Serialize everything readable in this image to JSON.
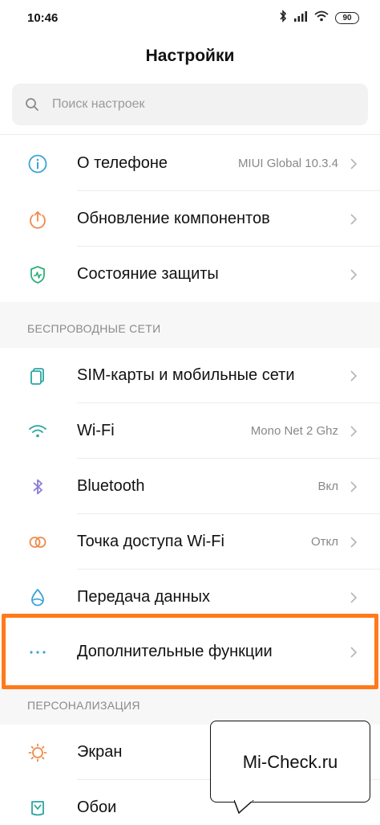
{
  "status_bar": {
    "time": "10:46",
    "battery": "90"
  },
  "header": {
    "title": "Настройки"
  },
  "search": {
    "placeholder": "Поиск настроек"
  },
  "rows_top": [
    {
      "label": "О телефоне",
      "value": "MIUI Global 10.3.4",
      "icon": "info-icon"
    },
    {
      "label": "Обновление компонентов",
      "value": "",
      "icon": "update-arrow-icon"
    },
    {
      "label": "Состояние защиты",
      "value": "",
      "icon": "shield-icon"
    }
  ],
  "section_wireless": {
    "title": "БЕСПРОВОДНЫЕ СЕТИ",
    "items": [
      {
        "label": "SIM-карты и мобильные сети",
        "value": "",
        "icon": "sim-card-icon"
      },
      {
        "label": "Wi-Fi",
        "value": "Mono Net 2 Ghz",
        "icon": "wifi-icon"
      },
      {
        "label": "Bluetooth",
        "value": "Вкл",
        "icon": "bluetooth-icon"
      },
      {
        "label": "Точка доступа Wi-Fi",
        "value": "Откл",
        "icon": "hotspot-icon"
      },
      {
        "label": "Передача данных",
        "value": "",
        "icon": "data-drop-icon"
      },
      {
        "label": "Дополнительные функции",
        "value": "",
        "icon": "more-dots-icon"
      }
    ]
  },
  "section_personal": {
    "title": "ПЕРСОНАЛИЗАЦИЯ",
    "items": [
      {
        "label": "Экран",
        "value": "",
        "icon": "display-sun-icon"
      },
      {
        "label": "Обои",
        "value": "",
        "icon": "wallpaper-icon"
      }
    ]
  },
  "watermark": {
    "text": "Mi-Check.ru"
  },
  "colors": {
    "highlight": "#ff7a1a",
    "icon_teal": "#2aa6a0",
    "icon_orange": "#f08a4b",
    "icon_purple": "#8d7bd6",
    "icon_blue": "#3aa3d7",
    "icon_green": "#2fb07c"
  }
}
